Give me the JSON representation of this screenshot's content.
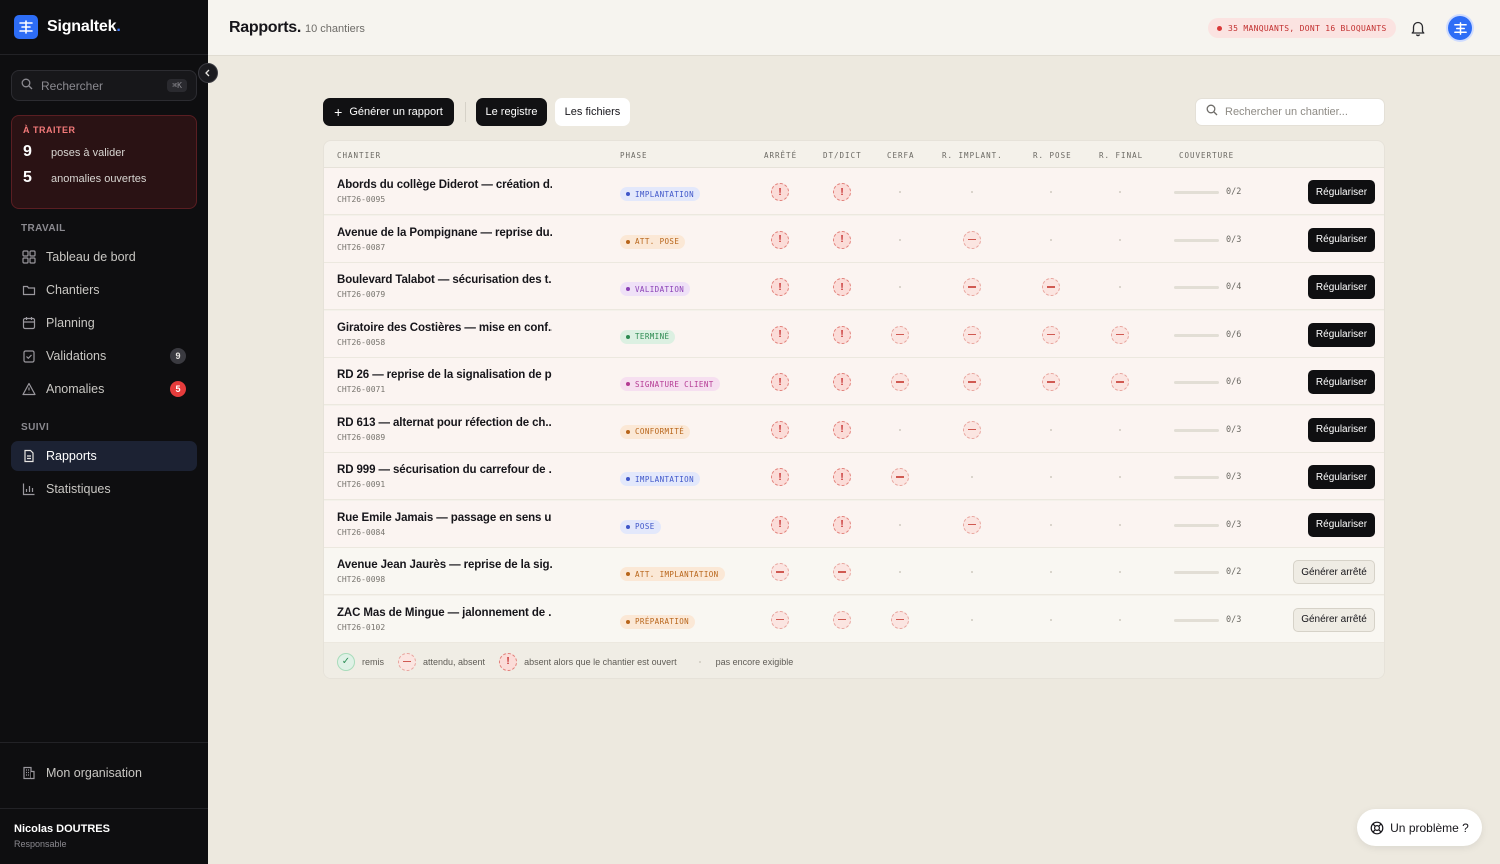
{
  "app": {
    "name": "Signaltek",
    "brand_dot": "."
  },
  "sidebar": {
    "search_placeholder": "Rechercher",
    "search_shortcut": "⌘K",
    "todo": {
      "title": "À TRAITER",
      "items": [
        {
          "count": "9",
          "label": "poses à valider"
        },
        {
          "count": "5",
          "label": "anomalies ouvertes"
        }
      ]
    },
    "section_work": "TRAVAIL",
    "section_follow": "SUIVI",
    "nav": {
      "dashboard": "Tableau de bord",
      "sites": "Chantiers",
      "planning": "Planning",
      "validations": "Validations",
      "validations_badge": "9",
      "anomalies": "Anomalies",
      "anomalies_badge": "5",
      "reports": "Rapports",
      "stats": "Statistiques"
    },
    "org": "Mon organisation",
    "user": {
      "name": "Nicolas DOUTRES",
      "role": "Responsable"
    }
  },
  "header": {
    "title": "Rapports.",
    "subtitle": "10 chantiers",
    "alert": "35 MANQUANTS, DONT 16 BLOQUANTS"
  },
  "toolbar": {
    "generate": "Générer un rapport",
    "tab_register": "Le registre",
    "tab_files": "Les fichiers",
    "search_placeholder": "Rechercher un chantier..."
  },
  "table": {
    "columns": {
      "site": "CHANTIER",
      "phase": "PHASE",
      "arrete": "ARRÊTÉ",
      "dtdict": "DT/DICT",
      "cerfa": "CERFA",
      "rimplant": "R. IMPLANT.",
      "rpose": "R. POSE",
      "rfinal": "R. FINAL",
      "coverage": "COUVERTURE"
    },
    "rows": [
      {
        "name": "Abords du collège Diderot — création d...",
        "code": "CHT26-0095",
        "phase": "IMPLANTATION",
        "phase_color": "blue",
        "statuses": [
          "miss",
          "miss",
          "na",
          "na",
          "na",
          "na"
        ],
        "coverage": "0/2",
        "action": "Régulariser",
        "action_type": "primary"
      },
      {
        "name": "Avenue de la Pompignane — reprise du...",
        "code": "CHT26-0087",
        "phase": "ATT. POSE",
        "phase_color": "orange",
        "statuses": [
          "miss",
          "miss",
          "na",
          "abs",
          "na",
          "na"
        ],
        "coverage": "0/3",
        "action": "Régulariser",
        "action_type": "primary"
      },
      {
        "name": "Boulevard Talabot — sécurisation des t...",
        "code": "CHT26-0079",
        "phase": "VALIDATION",
        "phase_color": "purple",
        "statuses": [
          "miss",
          "miss",
          "na",
          "abs",
          "abs",
          "na"
        ],
        "coverage": "0/4",
        "action": "Régulariser",
        "action_type": "primary"
      },
      {
        "name": "Giratoire des Costières — mise en conf...",
        "code": "CHT26-0058",
        "phase": "TERMINÉ",
        "phase_color": "green",
        "statuses": [
          "miss",
          "miss",
          "abs",
          "abs",
          "abs",
          "abs"
        ],
        "coverage": "0/6",
        "action": "Régulariser",
        "action_type": "primary"
      },
      {
        "name": "RD 26 — reprise de la signalisation de p...",
        "code": "CHT26-0071",
        "phase": "SIGNATURE CLIENT",
        "phase_color": "pink",
        "statuses": [
          "miss",
          "miss",
          "abs",
          "abs",
          "abs",
          "abs"
        ],
        "coverage": "0/6",
        "action": "Régulariser",
        "action_type": "primary"
      },
      {
        "name": "RD 613 — alternat pour réfection de ch...",
        "code": "CHT26-0089",
        "phase": "CONFORMITÉ",
        "phase_color": "orange",
        "statuses": [
          "miss",
          "miss",
          "na",
          "abs",
          "na",
          "na"
        ],
        "coverage": "0/3",
        "action": "Régulariser",
        "action_type": "primary"
      },
      {
        "name": "RD 999 — sécurisation du carrefour de ...",
        "code": "CHT26-0091",
        "phase": "IMPLANTATION",
        "phase_color": "blue",
        "statuses": [
          "miss",
          "miss",
          "abs",
          "na",
          "na",
          "na"
        ],
        "coverage": "0/3",
        "action": "Régulariser",
        "action_type": "primary"
      },
      {
        "name": "Rue Émile Jamais — passage en sens u...",
        "code": "CHT26-0084",
        "phase": "POSE",
        "phase_color": "blue",
        "statuses": [
          "miss",
          "miss",
          "na",
          "abs",
          "na",
          "na"
        ],
        "coverage": "0/3",
        "action": "Régulariser",
        "action_type": "primary"
      },
      {
        "name": "Avenue Jean Jaurès — reprise de la sig...",
        "code": "CHT26-0098",
        "phase": "ATT. IMPLANTATION",
        "phase_color": "orange",
        "statuses": [
          "abs",
          "abs",
          "na",
          "na",
          "na",
          "na"
        ],
        "coverage": "0/2",
        "action": "Générer arrêté",
        "action_type": "secondary"
      },
      {
        "name": "ZAC Mas de Mingue — jalonnement de ...",
        "code": "CHT26-0102",
        "phase": "PRÉPARATION",
        "phase_color": "orange",
        "statuses": [
          "abs",
          "abs",
          "abs",
          "na",
          "na",
          "na"
        ],
        "coverage": "0/3",
        "action": "Générer arrêté",
        "action_type": "secondary"
      }
    ],
    "legend": {
      "ok": "remis",
      "abs": "attendu, absent",
      "miss": "absent alors que le chantier est ouvert",
      "na": "pas encore exigible"
    }
  },
  "phase_colors": {
    "blue": {
      "bg": "#e3e8fb",
      "fg": "#3f56c9"
    },
    "orange": {
      "bg": "#fbe8d6",
      "fg": "#b8651a"
    },
    "purple": {
      "bg": "#efe1f7",
      "fg": "#8a3fb5"
    },
    "green": {
      "bg": "#dcf0e2",
      "fg": "#2d8a51"
    },
    "pink": {
      "bg": "#f6dff0",
      "fg": "#b43a93"
    }
  },
  "help": "Un problème ?"
}
